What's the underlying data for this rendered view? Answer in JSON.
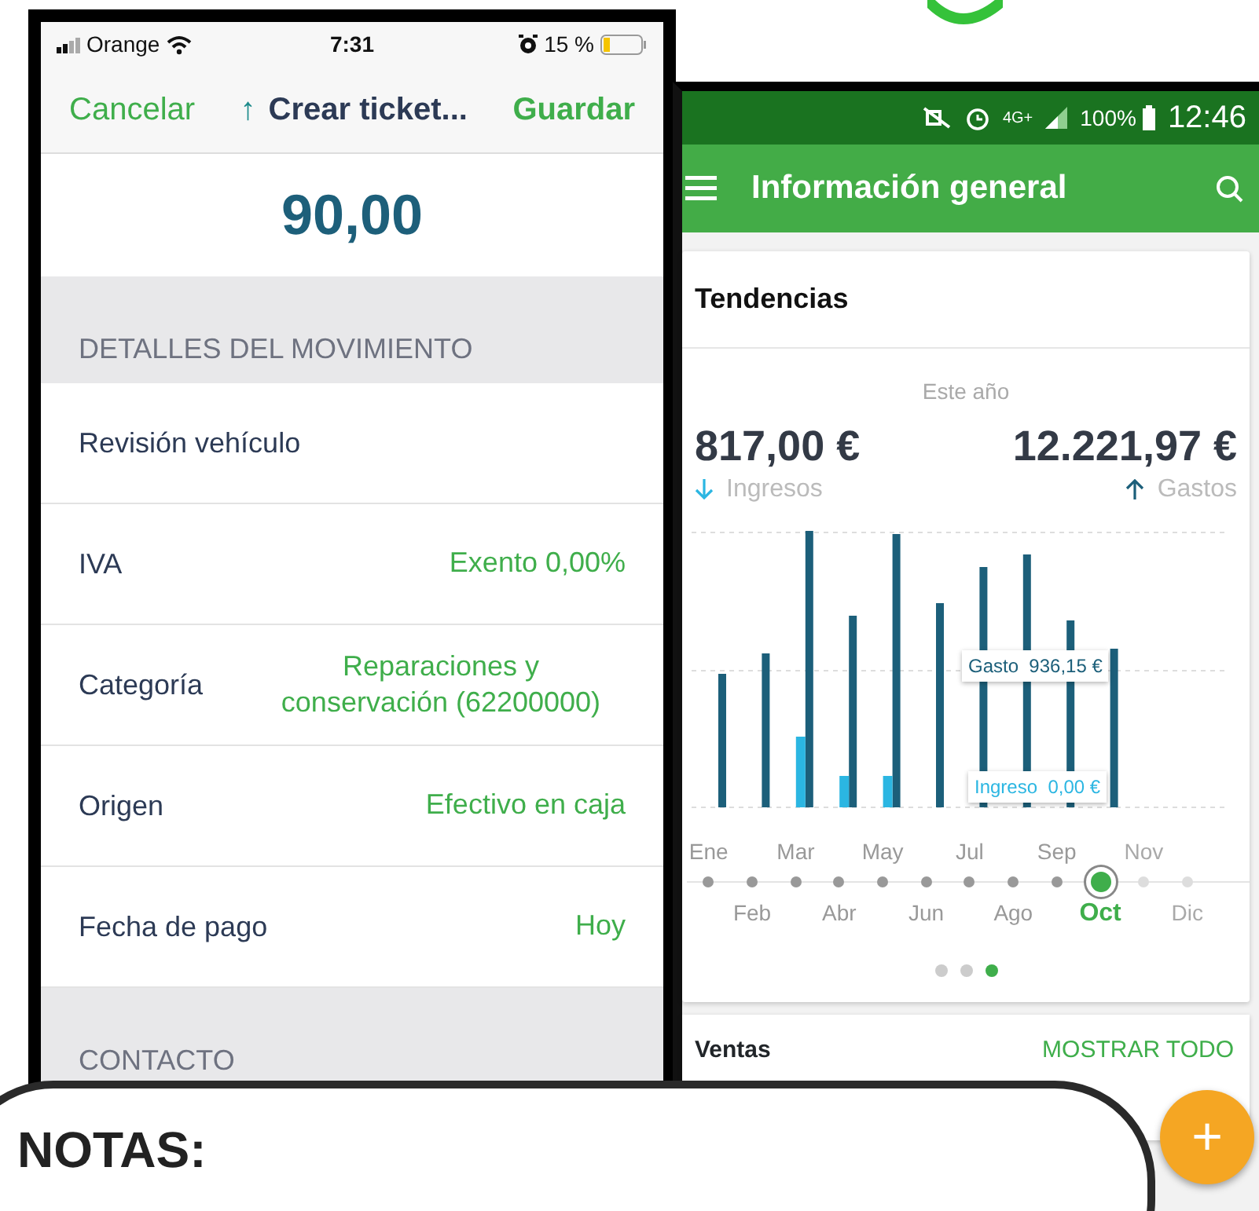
{
  "left_phone": {
    "status_bar": {
      "carrier": "Orange",
      "time": "7:31",
      "battery": "15 %"
    },
    "nav": {
      "cancel": "Cancelar",
      "arrow": "↑",
      "title": "Crear ticket...",
      "save": "Guardar"
    },
    "amount": "90,00",
    "sections": [
      {
        "header": "DETALLES DEL MOVIMIENTO",
        "rows": [
          {
            "label": "Revisión vehículo"
          },
          {
            "label": "IVA",
            "value": "Exento 0,00%"
          },
          {
            "label": "Categoría",
            "value": "Reparaciones y conservación (62200000)"
          },
          {
            "label": "Origen",
            "value": "Efectivo en caja"
          },
          {
            "label": "Fecha de pago",
            "value": "Hoy"
          }
        ]
      },
      {
        "header": "CONTACTO"
      }
    ]
  },
  "right_phone": {
    "status_bar": {
      "network": "4G+",
      "battery": "100%",
      "time": "12:46"
    },
    "app_bar": {
      "title": "Información general"
    },
    "trends_card": {
      "title": "Tendencias",
      "period": "Este año",
      "totals": [
        {
          "kind": "income",
          "amount": "817,00 €",
          "label": "Ingresos"
        },
        {
          "kind": "expense",
          "amount": "12.221,97 €",
          "label": "Gastos"
        }
      ],
      "tooltips": [
        {
          "kind": "expense",
          "label": "Gasto",
          "value": "936,15 €"
        },
        {
          "kind": "income",
          "label": "Ingreso",
          "value": "0,00 €"
        }
      ],
      "months": [
        {
          "label": "Ene",
          "selected": false,
          "disabled": false
        },
        {
          "label": "Feb",
          "selected": false,
          "disabled": false
        },
        {
          "label": "Mar",
          "selected": false,
          "disabled": false
        },
        {
          "label": "Abr",
          "selected": false,
          "disabled": false
        },
        {
          "label": "May",
          "selected": false,
          "disabled": false
        },
        {
          "label": "Jun",
          "selected": false,
          "disabled": false
        },
        {
          "label": "Jul",
          "selected": false,
          "disabled": false
        },
        {
          "label": "Ago",
          "selected": false,
          "disabled": false
        },
        {
          "label": "Sep",
          "selected": false,
          "disabled": false
        },
        {
          "label": "Oct",
          "selected": true,
          "disabled": false
        },
        {
          "label": "Nov",
          "selected": false,
          "disabled": true
        },
        {
          "label": "Dic",
          "selected": false,
          "disabled": true
        }
      ],
      "pages": [
        {
          "selected": false
        },
        {
          "selected": false
        },
        {
          "selected": true
        }
      ]
    },
    "sales_card": {
      "title": "Ventas",
      "action": "MOSTRAR TODO"
    },
    "fab": "+"
  },
  "notes": {
    "title": "NOTAS:"
  }
}
